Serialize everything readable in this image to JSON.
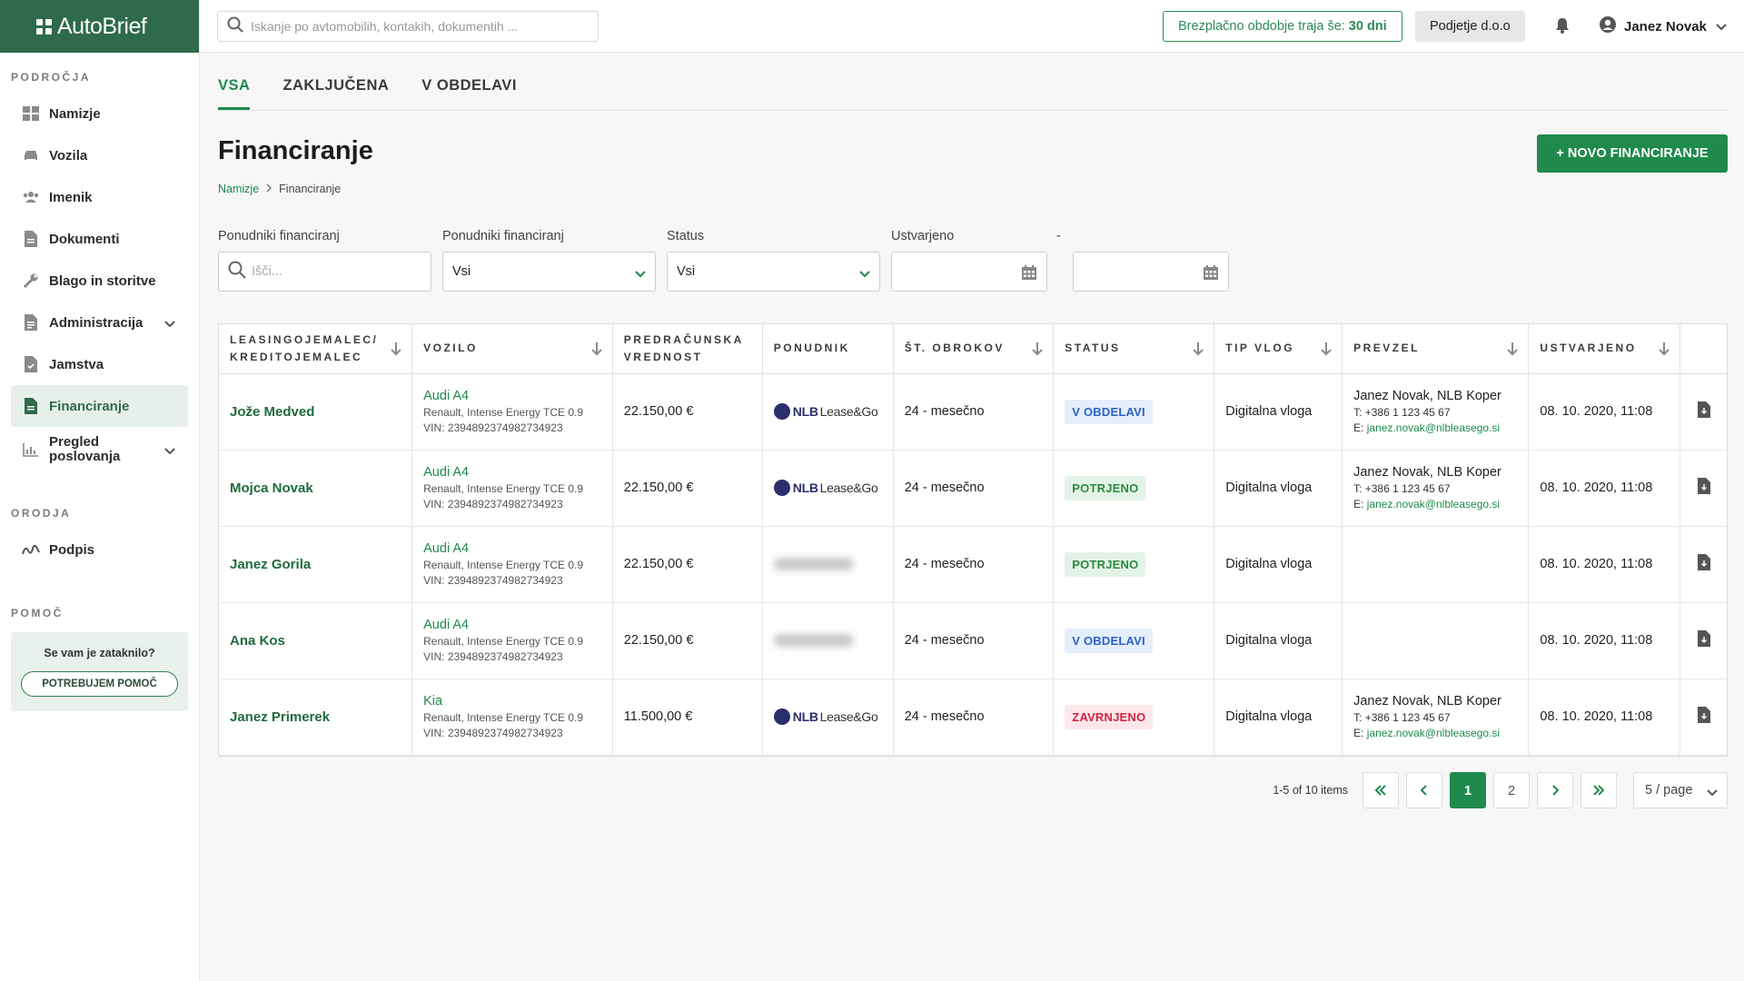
{
  "app": {
    "name": "AutoBrief"
  },
  "topbar": {
    "search_placeholder": "Iskanje po avtomobilih, kontakih, dokumentih ...",
    "trial_text": "Brezplačno obdobje traja še:",
    "trial_days": "30 dni",
    "company": "Podjetje d.o.o",
    "user_name": "Janez Novak"
  },
  "sidebar": {
    "sections": {
      "areas": "PODROČJA",
      "tools": "ORODJA",
      "help": "POMOČ"
    },
    "items": [
      {
        "label": "Namizje",
        "icon": "dashboard-icon"
      },
      {
        "label": "Vozila",
        "icon": "car-icon"
      },
      {
        "label": "Imenik",
        "icon": "contacts-icon"
      },
      {
        "label": "Dokumenti",
        "icon": "document-icon"
      },
      {
        "label": "Blago in storitve",
        "icon": "wrench-icon"
      },
      {
        "label": "Administracija",
        "icon": "admin-icon"
      },
      {
        "label": "Jamstva",
        "icon": "warranty-icon"
      },
      {
        "label": "Financiranje",
        "icon": "finance-icon"
      },
      {
        "label": "Pregled poslovanja",
        "icon": "chart-icon"
      }
    ],
    "tools": [
      {
        "label": "Podpis",
        "icon": "signature-icon"
      }
    ],
    "help_question": "Se vam je zataknilo?",
    "help_button": "POTREBUJEM POMOČ"
  },
  "tabs": [
    "VSA",
    "ZAKLJUČENA",
    "V OBDELAVI"
  ],
  "page": {
    "title": "Financiranje",
    "breadcrumb": [
      "Namizje",
      "Financiranje"
    ],
    "new_button": "+ NOVO FINANCIRANJE"
  },
  "filters": {
    "provider_search_label": "Ponudniki financiranj",
    "provider_search_placeholder": "Išči...",
    "provider_select_label": "Ponudniki financiranj",
    "provider_select_value": "Vsi",
    "status_label": "Status",
    "status_value": "Vsi",
    "created_label": "Ustvarjeno",
    "range_sep": "-"
  },
  "table": {
    "columns": [
      "LEASINGOJEMALEC/ KREDITOJEMALEC",
      "VOZILO",
      "PREDRAČUNSKA VREDNOST",
      "PONUDNIK",
      "ŠT. OBROKOV",
      "STATUS",
      "TIP VLOG",
      "PREVZEL",
      "USTVARJENO"
    ],
    "rows": [
      {
        "name": "Jože Medved",
        "car": "Audi A4",
        "car_desc": "Renault, Intense Energy TCE 0.9",
        "vin": "VIN: 2394892374982734923",
        "value": "22.150,00 €",
        "provider": "nlb",
        "provider_name": "NLB",
        "provider_tag": "Lease&Go",
        "installments": "24 - mesečno",
        "status": "V OBDELAVI",
        "status_type": "proc",
        "type": "Digitalna vloga",
        "taken_by": "Janez Novak, NLB Koper",
        "phone": "T: +386 1 123 45 67",
        "email_prefix": "E:",
        "email": "janez.novak@nlbleasego.si",
        "created": "08. 10. 2020, 11:08"
      },
      {
        "name": "Mojca Novak",
        "car": "Audi A4",
        "car_desc": "Renault, Intense Energy TCE 0.9",
        "vin": "VIN: 2394892374982734923",
        "value": "22.150,00 €",
        "provider": "nlb",
        "provider_name": "NLB",
        "provider_tag": "Lease&Go",
        "installments": "24 - mesečno",
        "status": "POTRJENO",
        "status_type": "ok",
        "type": "Digitalna vloga",
        "taken_by": "Janez Novak, NLB Koper",
        "phone": "T: +386 1 123 45 67",
        "email_prefix": "E:",
        "email": "janez.novak@nlbleasego.si",
        "created": "08. 10. 2020, 11:08"
      },
      {
        "name": "Janez Gorila",
        "car": "Audi A4",
        "car_desc": "Renault, Intense Energy TCE 0.9",
        "vin": "VIN: 2394892374982734923",
        "value": "22.150,00 €",
        "provider": "blurred",
        "installments": "24 - mesečno",
        "status": "POTRJENO",
        "status_type": "ok",
        "type": "Digitalna vloga",
        "taken_by": "",
        "created": "08. 10. 2020, 11:08"
      },
      {
        "name": "Ana Kos",
        "car": "Audi A4",
        "car_desc": "Renault, Intense Energy TCE 0.9",
        "vin": "VIN: 2394892374982734923",
        "value": "22.150,00 €",
        "provider": "blurred",
        "installments": "24 - mesečno",
        "status": "V OBDELAVI",
        "status_type": "proc",
        "type": "Digitalna vloga",
        "taken_by": "",
        "created": "08. 10. 2020, 11:08"
      },
      {
        "name": "Janez Primerek",
        "car": "Kia",
        "car_desc": "Renault, Intense Energy TCE 0.9",
        "vin": "VIN: 2394892374982734923",
        "value": "11.500,00 €",
        "provider": "nlb",
        "provider_name": "NLB",
        "provider_tag": "Lease&Go",
        "installments": "24 - mesečno",
        "status": "ZAVRNJENO",
        "status_type": "rej",
        "type": "Digitalna vloga",
        "taken_by": "Janez Novak, NLB Koper",
        "phone": "T: +386 1 123 45 67",
        "email_prefix": "E:",
        "email": "janez.novak@nlbleasego.si",
        "created": "08. 10. 2020, 11:08"
      }
    ]
  },
  "pagination": {
    "info": "1-5 of 10 items",
    "pages": [
      "1",
      "2"
    ],
    "current": "1",
    "page_size": "5 / page"
  },
  "colors": {
    "brand": "#2e6a4b",
    "accent": "#1e8a4c",
    "processing": "#2a62c8",
    "rejected": "#d32340"
  }
}
